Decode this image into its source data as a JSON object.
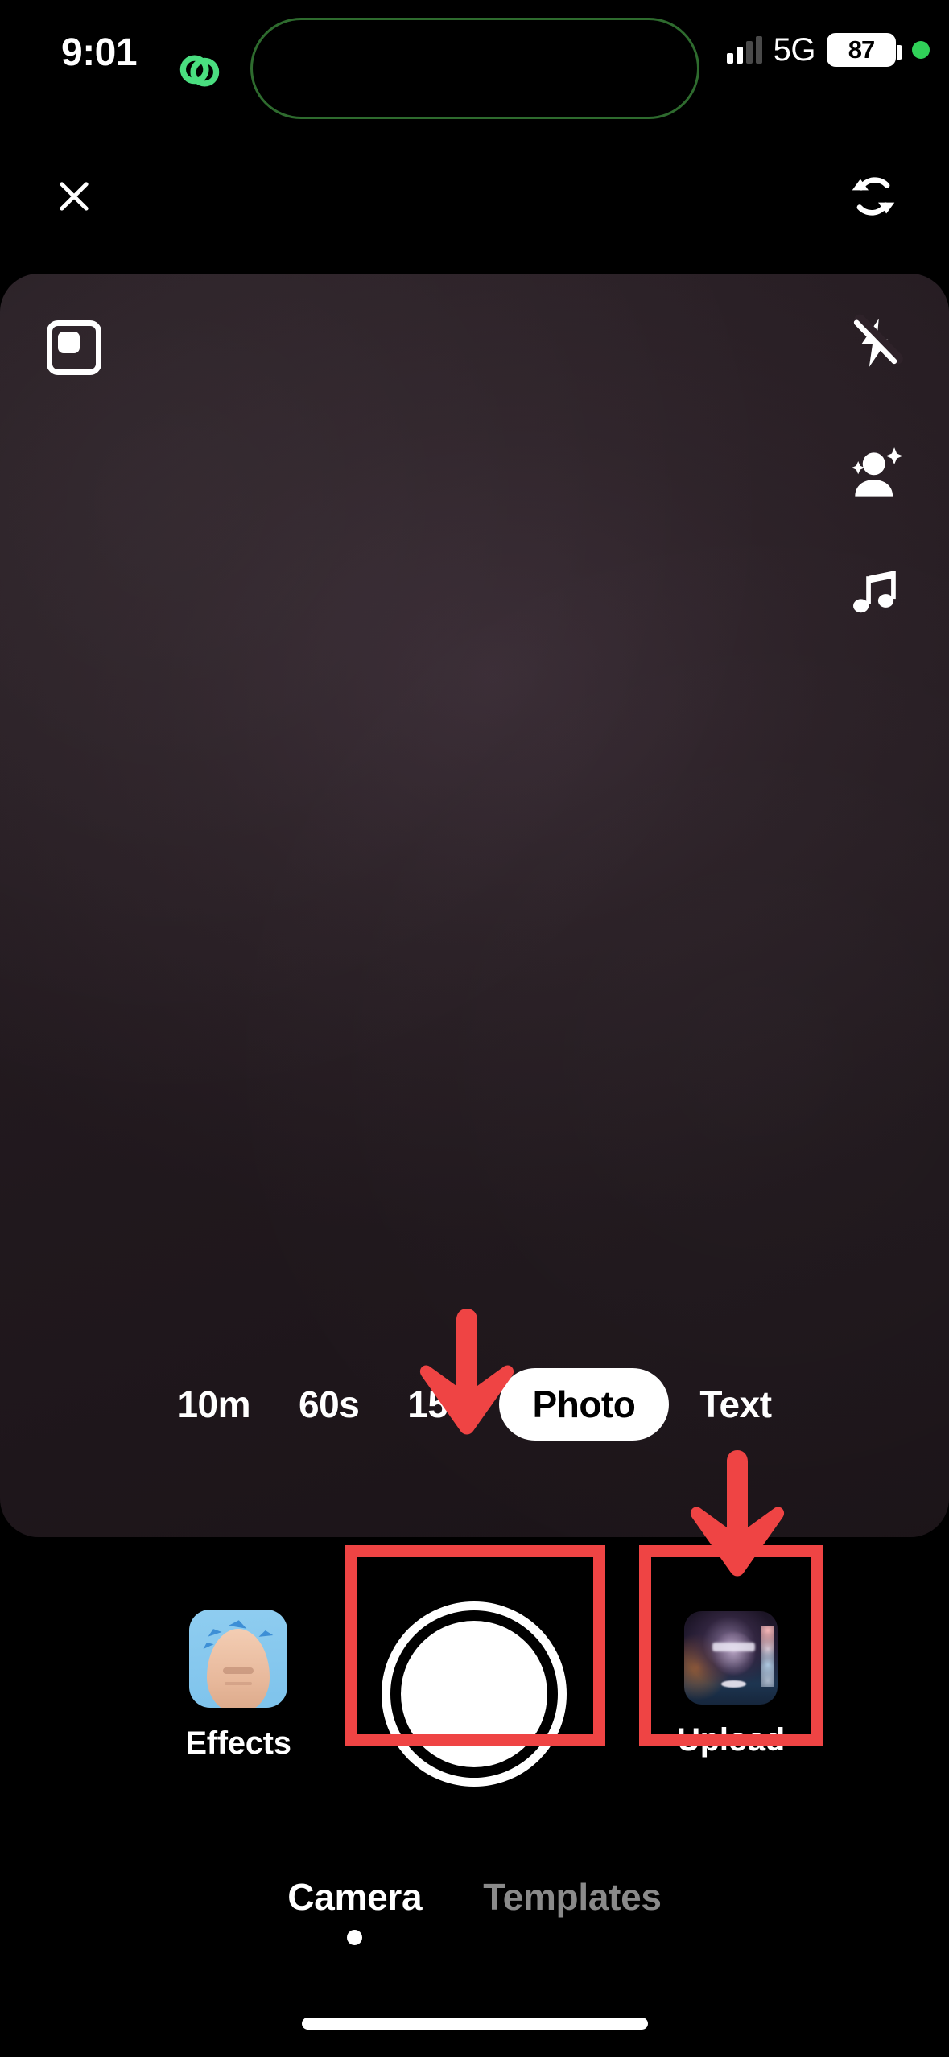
{
  "status_bar": {
    "time": "9:01",
    "network_label": "5G",
    "battery_level": "87",
    "signal_icon": "signal-bars-icon",
    "privacy_indicator_icon": "green-privacy-dot-icon",
    "island_activity_icon": "link-loop-icon",
    "island_accent_color": "#30d158"
  },
  "top_bar": {
    "close_icon": "close-x-icon",
    "flip_camera_icon": "flip-camera-icon"
  },
  "camera_preview": {
    "aspect_ratio_icon": "aspect-ratio-square-icon",
    "flash_icon": "flash-off-icon",
    "beauty_icon": "beauty-person-sparkle-icon",
    "music_icon": "music-note-icon",
    "background_color": "#2e2229"
  },
  "mode_selector": {
    "modes": [
      {
        "label": "10m",
        "selected": false
      },
      {
        "label": "60s",
        "selected": false
      },
      {
        "label": "15s",
        "selected": false
      },
      {
        "label": "Photo",
        "selected": true
      },
      {
        "label": "Text",
        "selected": false
      }
    ],
    "selected_mode": "Photo"
  },
  "bottom_controls": {
    "effects_label": "Effects",
    "effects_icon": "effects-face-icon",
    "shutter_icon": "shutter-button-icon",
    "upload_label": "Upload",
    "upload_icon": "upload-thumbnail-icon"
  },
  "annotations": {
    "color": "#ef4444",
    "arrow_to_photo_mode": "down-arrow-icon",
    "arrow_to_upload": "down-arrow-icon",
    "box_around_shutter": "highlight-box",
    "box_around_upload": "highlight-box"
  },
  "tab_bar": {
    "tabs": [
      {
        "label": "Camera",
        "active": true
      },
      {
        "label": "Templates",
        "active": false
      }
    ],
    "active_color": "#ffffff",
    "inactive_color": "#8a8a8a"
  },
  "home_indicator": "home-indicator-bar"
}
